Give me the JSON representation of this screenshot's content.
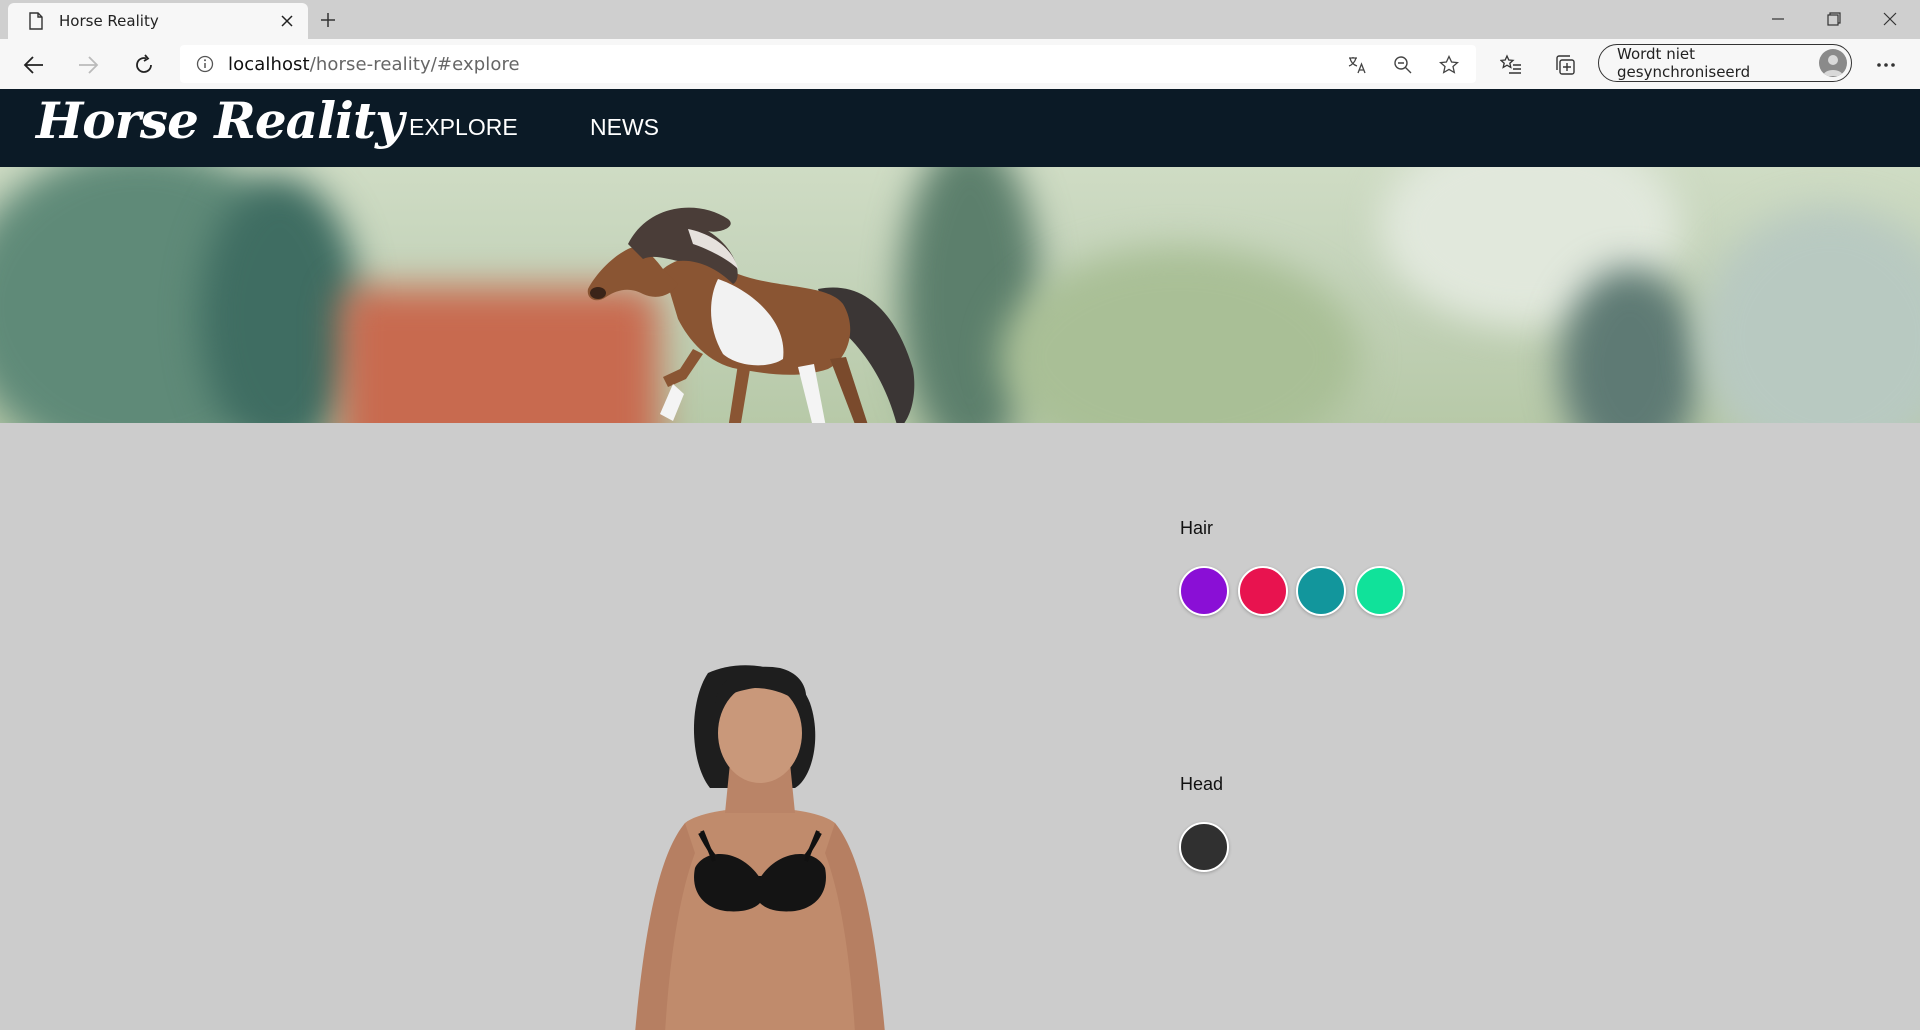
{
  "browser": {
    "tab_title": "Horse Reality",
    "url_host": "localhost",
    "url_path": "/horse-reality/#explore",
    "sync_label": "Wordt niet gesynchroniseerd",
    "icons": [
      "page-icon",
      "close-icon",
      "plus-icon",
      "minimize-icon",
      "restore-icon",
      "close-window-icon",
      "back-icon",
      "forward-icon",
      "refresh-icon",
      "info-icon",
      "translate-icon",
      "zoom-out-icon",
      "star-icon",
      "favorites-icon",
      "collections-icon",
      "profile-icon",
      "more-icon"
    ]
  },
  "site": {
    "logo": "Horse Reality",
    "nav": [
      {
        "label": "EXPLORE"
      },
      {
        "label": "NEWS"
      }
    ]
  },
  "customizer": {
    "hair": {
      "label": "Hair",
      "swatches": [
        "#8a0fd6",
        "#e8134f",
        "#12969c",
        "#10e29a"
      ]
    },
    "head": {
      "label": "Head",
      "swatches": [
        "#303030"
      ]
    }
  }
}
